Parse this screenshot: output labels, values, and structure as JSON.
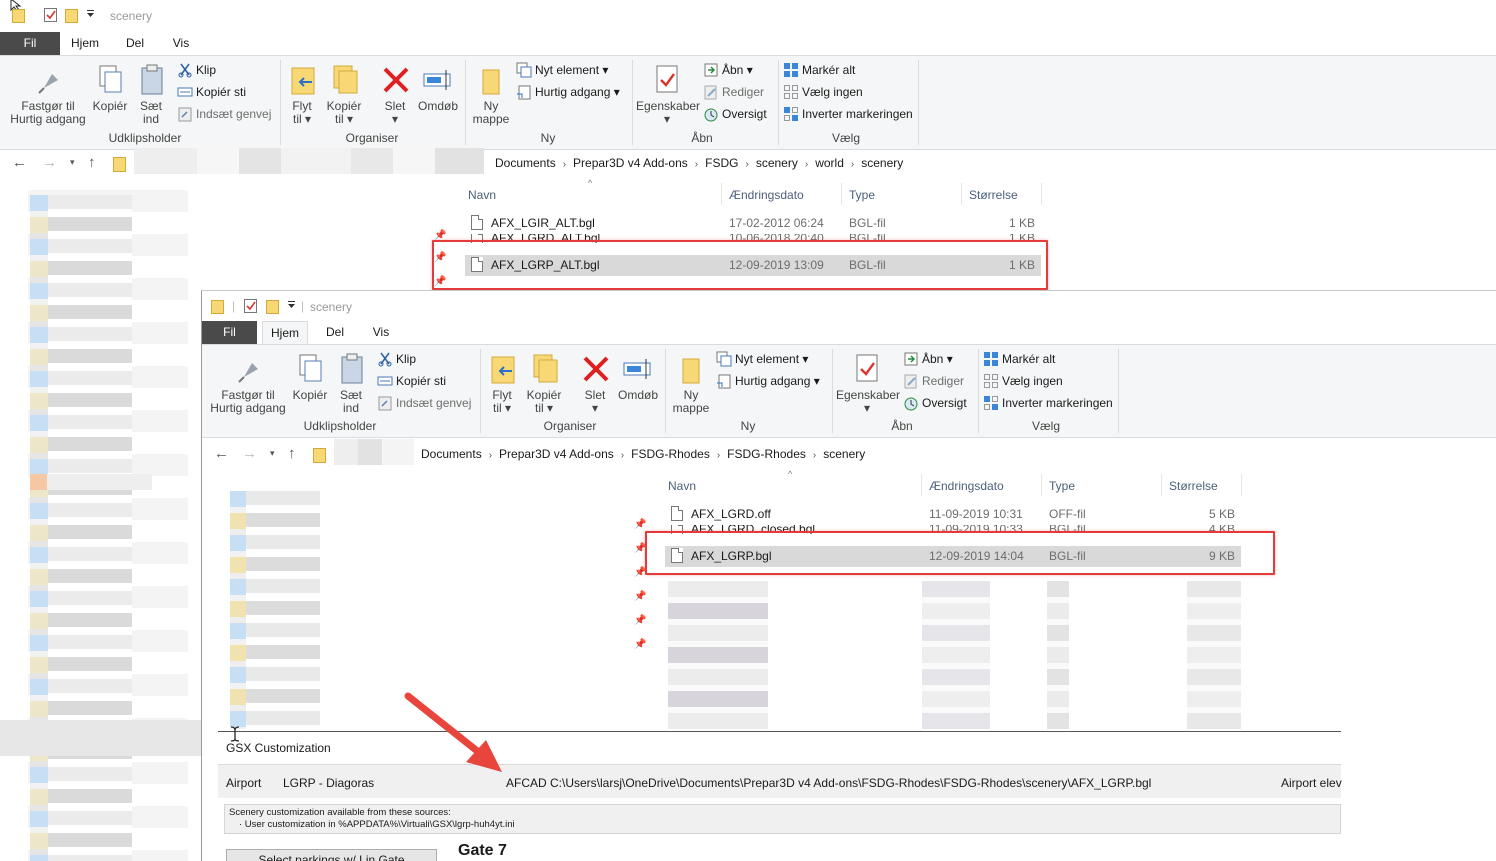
{
  "back_window": {
    "title": "scenery",
    "menu": {
      "file": "Fil",
      "home": "Hjem",
      "share": "Del",
      "view": "Vis"
    },
    "ribbon": {
      "clipboard": {
        "pin_label_1": "Fastgør til",
        "pin_label_2": "Hurtig adgang",
        "copy": "Kopiér",
        "paste_1": "Sæt",
        "paste_2": "ind",
        "cut": "Klip",
        "copy_path": "Kopiér sti",
        "paste_shortcut": "Indsæt genvej",
        "group": "Udklipsholder"
      },
      "organize": {
        "move_1": "Flyt",
        "move_2": "til",
        "copyto_1": "Kopiér",
        "copyto_2": "til",
        "delete": "Slet",
        "rename": "Omdøb",
        "group": "Organiser"
      },
      "new": {
        "folder_1": "Ny",
        "folder_2": "mappe",
        "new_item": "Nyt element",
        "easy_access": "Hurtig adgang",
        "group": "Ny"
      },
      "open": {
        "properties": "Egenskaber",
        "open": "Åbn",
        "edit": "Rediger",
        "history": "Oversigt",
        "group": "Åbn"
      },
      "select": {
        "select_all": "Markér alt",
        "select_none": "Vælg ingen",
        "invert": "Inverter markeringen",
        "group": "Vælg"
      }
    },
    "breadcrumbs": [
      "Documents",
      "Prepar3D v4 Add-ons",
      "FSDG",
      "scenery",
      "world",
      "scenery"
    ],
    "columns": {
      "name": "Navn",
      "date": "Ændringsdato",
      "type": "Type",
      "size": "Størrelse"
    },
    "files": [
      {
        "name": "AFX_LGIR_ALT.bgl",
        "date": "17-02-2012 06:24",
        "type": "BGL-fil",
        "size": "1 KB"
      },
      {
        "name": "AFX_LGRD_ALT.bgl",
        "date": "10-06-2018 20:40",
        "type": "BGL-fil",
        "size": "1 KB"
      },
      {
        "name": "AFX_LGRP_ALT.bgl",
        "date": "12-09-2019 13:09",
        "type": "BGL-fil",
        "size": "1 KB"
      }
    ]
  },
  "front_window": {
    "title": "scenery",
    "breadcrumbs": [
      "Documents",
      "Prepar3D v4 Add-ons",
      "FSDG-Rhodes",
      "FSDG-Rhodes",
      "scenery"
    ],
    "files": [
      {
        "name": "AFX_LGRD.off",
        "date": "11-09-2019 10:31",
        "type": "OFF-fil",
        "size": "5 KB"
      },
      {
        "name": "AFX_LGRD_closed.bgl",
        "date": "11-09-2019 10:33",
        "type": "BGL-fil",
        "size": "4 KB"
      },
      {
        "name": "AFX_LGRP.bgl",
        "date": "12-09-2019 14:04",
        "type": "BGL-fil",
        "size": "9 KB"
      }
    ]
  },
  "gsx": {
    "title": "GSX Customization",
    "airport_label": "Airport",
    "airport_value": "LGRP - Diagoras",
    "afcad_label": "AFCAD",
    "afcad_path": "C:\\Users\\larsj\\OneDrive\\Documents\\Prepar3D v4 Add-ons\\FSDG-Rhodes\\FSDG-Rhodes\\scenery\\AFX_LGRP.bgl",
    "airport_elev": "Airport elev",
    "sources_line1": "Scenery customization available from these sources:",
    "sources_line2": "· User customization in %APPDATA%\\Virtuali\\GSX\\lgrp-huh4yt.ini",
    "select_parkings": "Select parkings w/ Lin Gate",
    "gate": "Gate 7"
  },
  "colors": {
    "highlight_box": "#e43a3a",
    "arrow": "#e8453c",
    "file_tab": "#4a4a4a",
    "selection": "#d9d9d9"
  }
}
